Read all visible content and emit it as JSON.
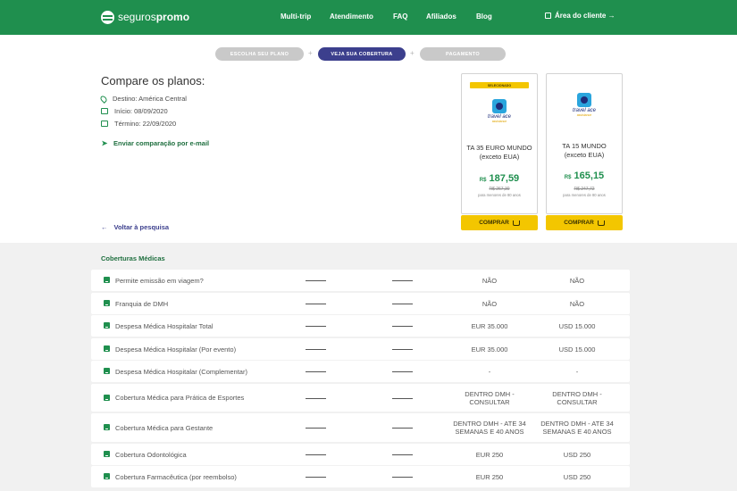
{
  "header": {
    "logo_light": "seguros",
    "logo_bold": "promo",
    "nav": [
      "Multi-trip",
      "Atendimento",
      "FAQ",
      "Afiliados",
      "Blog"
    ],
    "client_area": "Área do cliente →"
  },
  "steps": [
    "ESCOLHA SEU PLANO",
    "VEJA SUA COBERTURA",
    "PAGAMENTO"
  ],
  "compare": {
    "title": "Compare os planos:",
    "destino": "Destino: América Central",
    "inicio": "Início: 08/09/2020",
    "termino": "Término: 22/09/2020",
    "email": "Enviar comparação por e-mail",
    "back": "Voltar à pesquisa"
  },
  "plans": [
    {
      "badge": "SELECIONADO",
      "brand": "travel ace",
      "brand_sub": "assistance",
      "name": "TA 35 EURO MUNDO (exceto EUA)",
      "currency": "R$",
      "price": "187,59",
      "old_price": "R$ 267,30",
      "note": "para menores de 80 anos",
      "buy": "COMPRAR"
    },
    {
      "brand": "travel ace",
      "brand_sub": "assistance",
      "name": "TA 15 MUNDO (exceto EUA)",
      "currency": "R$",
      "price": "165,15",
      "old_price": "R$ 247,72",
      "note": "para menores de 80 anos",
      "buy": "COMPRAR"
    }
  ],
  "coverage": {
    "section": "Coberturas Médicas",
    "rows": [
      {
        "label": "Permite emissão em viagem?",
        "v1": "NÃO",
        "v2": "NÃO"
      },
      {
        "label": "Franquia de DMH",
        "v1": "NÃO",
        "v2": "NÃO"
      },
      {
        "label": "Despesa Médica Hospitalar Total",
        "v1": "EUR 35.000",
        "v2": "USD 15.000"
      },
      {
        "label": "Despesa Médica Hospitalar (Por evento)",
        "v1": "EUR 35.000",
        "v2": "USD 15.000"
      },
      {
        "label": "Despesa Médica Hospitalar (Complementar)",
        "v1": "-",
        "v2": "-"
      },
      {
        "label": "Cobertura Médica para Prática de Esportes",
        "v1": "DENTRO DMH - CONSULTAR",
        "v2": "DENTRO DMH - CONSULTAR"
      },
      {
        "label": "Cobertura Médica para Gestante",
        "v1": "DENTRO DMH - ATE 34 SEMANAS E 40 ANOS",
        "v2": "DENTRO DMH - ATE 34 SEMANAS E 40 ANOS"
      },
      {
        "label": "Cobertura Odontológica",
        "v1": "EUR 250",
        "v2": "USD 250"
      },
      {
        "label": "Cobertura Farmacêutica (por reembolso)",
        "v1": "EUR 250",
        "v2": "USD 250"
      }
    ]
  }
}
